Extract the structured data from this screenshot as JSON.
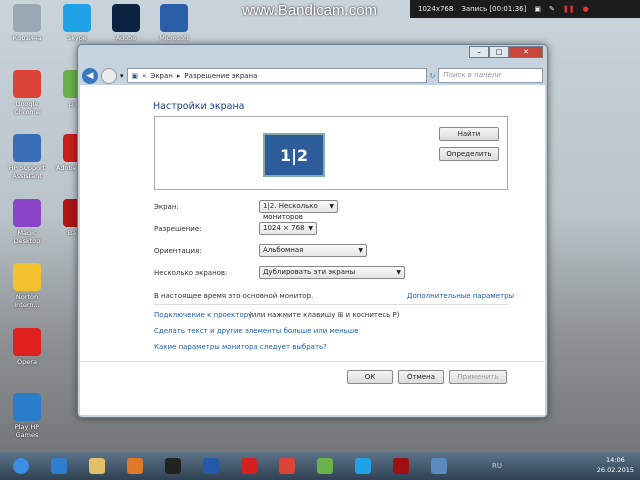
{
  "watermark": "www.Bandicam.com",
  "recorder": {
    "resolution": "1024x768",
    "status": "Запись [00:01:36]"
  },
  "desktop_icons": [
    {
      "label": "Корзина",
      "color": "#9aa8b5"
    },
    {
      "label": "Skype",
      "color": "#1fa3e6"
    },
    {
      "label": "Adobe",
      "color": "#0b2340"
    },
    {
      "label": "Microsoft",
      "color": "#2b5ea8"
    },
    {
      "label": "Google Chrome",
      "color": "#db4437"
    },
    {
      "label": "µTorr",
      "color": "#6ab04c"
    },
    {
      "label": "HP Support Assistant",
      "color": "#3b6fb5"
    },
    {
      "label": "Adobe Creati",
      "color": "#c8201e"
    },
    {
      "label": "Magic Desktop",
      "color": "#8a44c8"
    },
    {
      "label": "Bandi",
      "color": "#b01515"
    },
    {
      "label": "Norton Intern...",
      "color": "#f2c230"
    },
    {
      "label": "Opera",
      "color": "#e0201e"
    },
    {
      "label": "Play HP Games",
      "color": "#2a7dc9"
    }
  ],
  "window": {
    "breadcrumb": [
      "Экран",
      "Разрешение экрана"
    ],
    "search_placeholder": "Поиск в панели управления",
    "title": "Настройки экрана",
    "monitor_label": "1|2",
    "find_button": "Найти",
    "identify_button": "Определить",
    "fields": [
      {
        "label": "Экран:",
        "value": "1|2. Несколько мониторов"
      },
      {
        "label": "Разрешение:",
        "value": "1024 × 768"
      },
      {
        "label": "Ориентация:",
        "value": "Альбомная"
      },
      {
        "label": "Несколько экранов:",
        "value": "Дублировать эти экраны"
      }
    ],
    "primary_note": "В настоящее время это основной монитор.",
    "advanced_link": "Дополнительные параметры",
    "projector_link": "Подключение к проектору",
    "projector_hint": "(или нажмите клавишу ⊞ и коснитесь P)",
    "text_size_link": "Сделать текст и другие элементы больше или меньше",
    "monitor_help_link": "Какие параметры монитора следует выбрать?",
    "ok": "ОК",
    "cancel": "Отмена",
    "apply": "Применить"
  },
  "taskbar": {
    "lang": "RU",
    "time": "14:06",
    "date": "26.02.2015",
    "apps": [
      "start",
      "ie",
      "explorer",
      "media",
      "hp",
      "check",
      "opera",
      "chrome",
      "utorrent",
      "skype",
      "bandicam",
      "control-panel"
    ]
  }
}
